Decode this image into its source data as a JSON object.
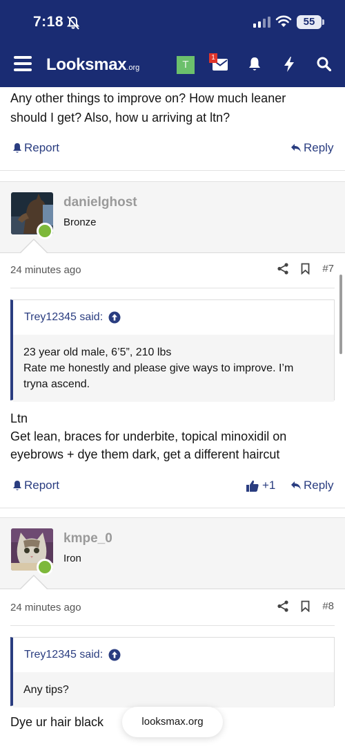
{
  "status_bar": {
    "time": "7:18",
    "battery": "55"
  },
  "navbar": {
    "logo_main": "Looksmax",
    "logo_suffix": ".org",
    "avatar_letter": "T",
    "mail_badge": "1"
  },
  "first_post": {
    "text_lines": [
      "Any other things to improve on? How much leaner",
      "should I get? Also, how u arriving at ltn?"
    ],
    "report_label": "Report",
    "reply_label": "Reply"
  },
  "posts": [
    {
      "username": "danielghost",
      "rank": "Bronze",
      "time": "24 minutes ago",
      "number": "#7",
      "quote_author": "Trey12345 said:",
      "quote_lines": [
        "23 year old male, 6’5”, 210 lbs",
        "Rate me honestly and please give ways to improve. I’m",
        "tryna ascend."
      ],
      "body_lines": [
        "Ltn",
        "Get lean, braces for underbite, topical minoxidil on",
        "eyebrows + dye them dark, get a different haircut"
      ],
      "report_label": "Report",
      "reaction_count": "+1",
      "reply_label": "Reply"
    },
    {
      "username": "kmpe_0",
      "rank": "Iron",
      "time": "24 minutes ago",
      "number": "#8",
      "quote_author": "Trey12345 said:",
      "quote_lines": [
        "Any tips?"
      ],
      "body_lines": [
        "Dye ur hair black"
      ]
    }
  ],
  "browser": {
    "domain": "looksmax.org"
  },
  "colors": {
    "navy": "#1a2c73",
    "link": "#2a3d80",
    "online": "#7db83a",
    "badge": "#e0352b"
  },
  "icons": [
    "silent-bell-icon",
    "signal-icon",
    "wifi-icon",
    "battery-icon",
    "hamburger-icon",
    "mail-icon",
    "bell-icon",
    "bolt-icon",
    "search-icon",
    "report-bell-icon",
    "reply-arrow-icon",
    "share-icon",
    "bookmark-icon",
    "thumbs-up-icon",
    "arrow-up-circle-icon"
  ]
}
